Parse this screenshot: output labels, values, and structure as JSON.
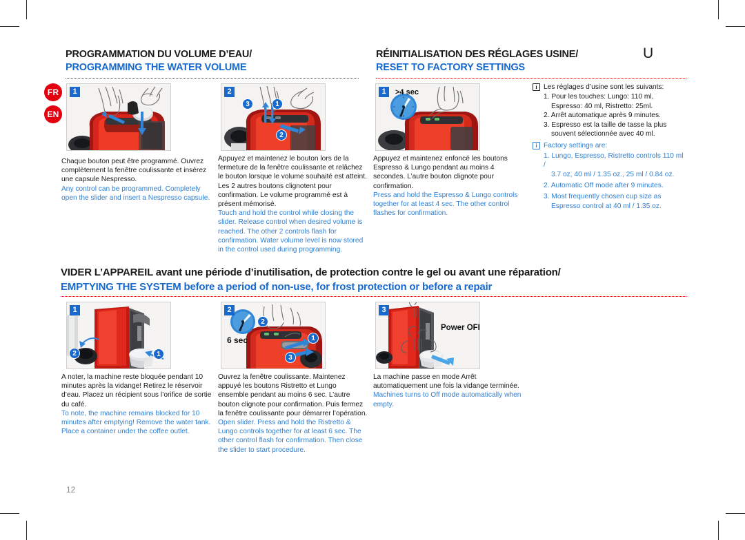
{
  "page": {
    "number": "12",
    "corner_mark": "U",
    "accent_red": "#e3000f",
    "accent_blue": "#1769cd",
    "copy_blue": "#2f7fd1"
  },
  "languages": [
    {
      "code": "FR"
    },
    {
      "code": "EN"
    }
  ],
  "sections": [
    {
      "id": "programming",
      "title_fr": "PROGRAMMATION DU VOLUME D’EAU/",
      "title_en": "PROGRAMMING THE WATER VOLUME"
    },
    {
      "id": "reset",
      "title_fr": "RÉINITIALISATION DES RÉGLAGES USINE/",
      "title_en": "RESET TO FACTORY SETTINGS"
    },
    {
      "id": "emptying",
      "title_fr": "VIDER L’APPAREIL avant une période d’inutilisation, de protection contre le gel ou avant une réparation/",
      "title_en": "EMPTYING THE SYSTEM before a period of non-use, for frost protection or before a repair"
    }
  ],
  "steps": {
    "prog1": {
      "number": "1",
      "caption_fr": "Chaque bouton peut être programmé. Ouvrez complètement la fenêtre coulissante et insérez une capsule Nespresso.",
      "caption_en": "Any control can be programmed.  Completely open the slider and insert a Nespresso capsule.",
      "callouts": []
    },
    "prog2": {
      "number": "2",
      "caption_fr": "Appuyez et maintenez le bouton  lors de la fermeture de la fenêtre coulissante et relâchez le bouton lorsque le volume souhaité est atteint. Les 2 autres boutons clignotent pour confirmation. Le volume programmé est à présent mémorisé.",
      "caption_en": "Touch and hold the control while closing the slider. Release control when desired volume is reached. The other 2 controls flash for confirmation. Water volume level is now stored in the control used during programming.",
      "callouts": [
        "3",
        "1",
        "2"
      ]
    },
    "reset1": {
      "number": "1",
      "label": ">4 sec",
      "caption_fr": "Appuyez et maintenez enfoncé les boutons Espresso & Lungo pendant au moins 4 secondes. L’autre bouton clignote pour confirmation.",
      "caption_en": "Press and hold the Espresso & Lungo controls together for at least 4 sec. The other control flashes for confirmation."
    },
    "empty1": {
      "number": "1",
      "caption_fr": "A noter, la machine reste bloquée pendant 10 minutes après la vidange!  Retirez le réservoir d’eau. Placez un récipient sous l’orifice de sortie du café.",
      "caption_en": "To note, the machine remains blocked for 10 minutes after emptying! Remove the water tank. Place a container under the coffee outlet.",
      "callouts": [
        "2",
        "1"
      ]
    },
    "empty2": {
      "number": "2",
      "label": "6 sec",
      "caption_fr": "Ouvrez la fenêtre coulissante. Maintenez appuyé les boutons Ristretto et Lungo ensemble pendant au moins 6 sec.  L’autre bouton clignote pour confirmation. Puis fermez la fenêtre coulissante pour démarrer l’opération.",
      "caption_en": "Open slider. Press and hold the Ristretto & Lungo controls together for at least 6 sec. The other control flash for confirmation. Then close the slider to start procedure.",
      "callouts": [
        "2",
        "1",
        "3"
      ]
    },
    "empty3": {
      "number": "3",
      "label": "Power OFF",
      "caption_fr": "La machine passe en mode Arrêt automatiquement une fois la vidange terminée.",
      "caption_en": "Machines turns to Off mode automatically when empty."
    }
  },
  "factory_info": {
    "icon": "info-icon",
    "fr": {
      "heading": "Les réglages d’usine sont les suivants:",
      "items": [
        "1. Pour les touches: Lungo: 110 ml,",
        "Espresso: 40 ml, Ristretto: 25ml.",
        "2. Arrêt automatique après 9 minutes.",
        "3. Espresso est la taille de tasse la plus",
        "souvent sélectionnée avec 40 ml."
      ]
    },
    "en": {
      "heading": "Factory settings are:",
      "items": [
        "1. Lungo, Espresso, Ristretto controls 110 ml /",
        "3.7 oz, 40 ml / 1.35 oz., 25 ml / 0.84 oz.",
        "2. Automatic Off mode after 9 minutes.",
        "3. Most frequently chosen cup size as",
        "Espresso control at 40 ml / 1.35 oz."
      ]
    }
  }
}
